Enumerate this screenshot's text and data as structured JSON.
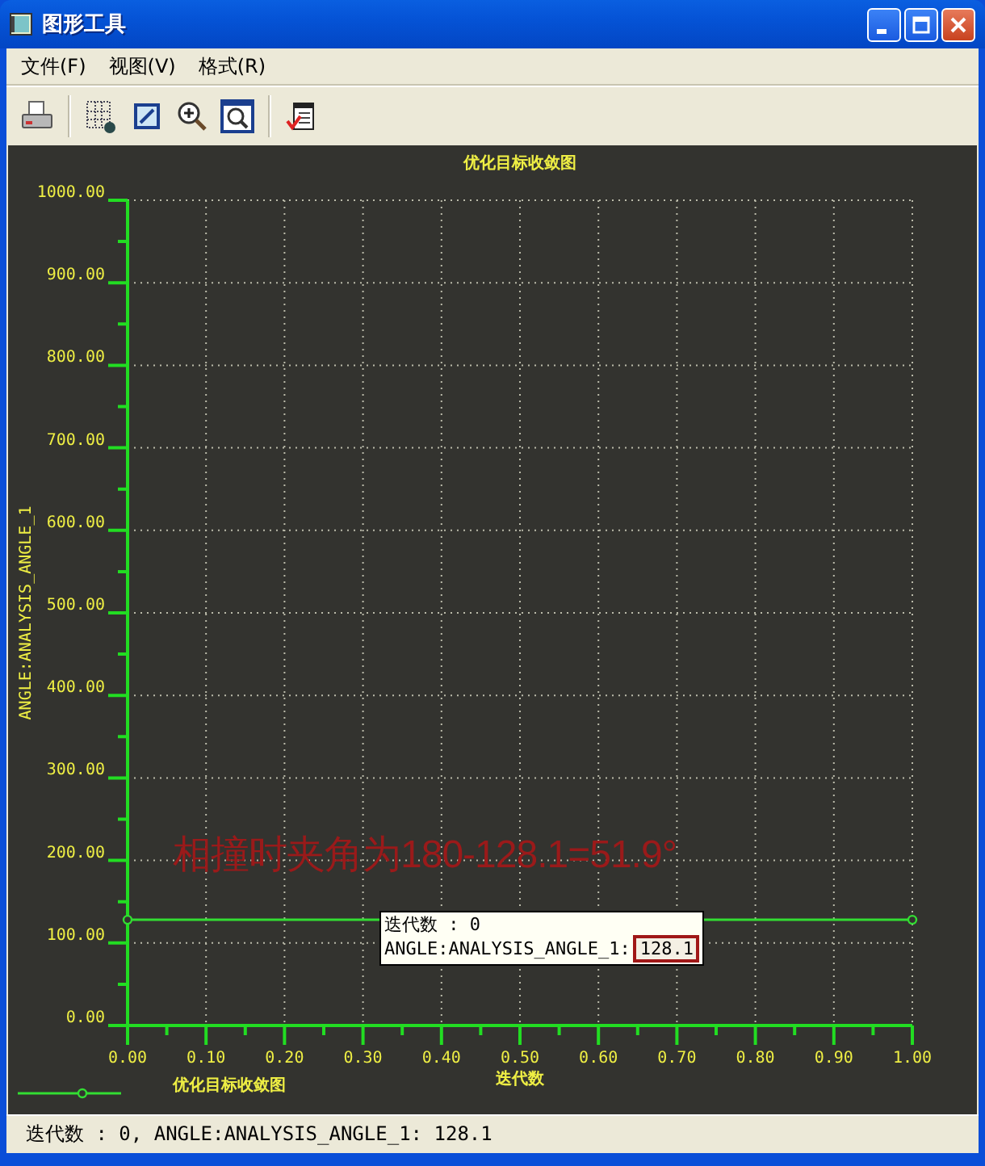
{
  "window": {
    "title": "图形工具"
  },
  "menu": [
    {
      "label": "文件(F)"
    },
    {
      "label": "视图(V)"
    },
    {
      "label": "格式(R)"
    }
  ],
  "chart": {
    "chart_data": {
      "type": "line",
      "title": "优化目标收敛图",
      "xlabel": "迭代数",
      "ylabel": "ANGLE:ANALYSIS_ANGLE_1",
      "x": [
        0,
        1
      ],
      "series": [
        {
          "name": "优化目标收敛图",
          "color": "#33dd33",
          "values": [
            128.1,
            128.1
          ]
        }
      ],
      "xlim": [
        0,
        1
      ],
      "ylim": [
        0,
        1000
      ],
      "grid": true,
      "marker": true,
      "xticks": [
        {
          "value": 0,
          "label": "0.00"
        },
        {
          "value": 0.1,
          "label": "0.10"
        },
        {
          "value": 0.2,
          "label": "0.20"
        },
        {
          "value": 0.3,
          "label": "0.30"
        },
        {
          "value": 0.4,
          "label": "0.40"
        },
        {
          "value": 0.5,
          "label": "0.50"
        },
        {
          "value": 0.6,
          "label": "0.60"
        },
        {
          "value": 0.7,
          "label": "0.70"
        },
        {
          "value": 0.8,
          "label": "0.80"
        },
        {
          "value": 0.9,
          "label": "0.90"
        },
        {
          "value": 1,
          "label": "1.00"
        }
      ],
      "yticks": [
        {
          "value": 0,
          "label": "0.00"
        },
        {
          "value": 100,
          "label": "100.00"
        },
        {
          "value": 200,
          "label": "200.00"
        },
        {
          "value": 300,
          "label": "300.00"
        },
        {
          "value": 400,
          "label": "400.00"
        },
        {
          "value": 500,
          "label": "500.00"
        },
        {
          "value": 600,
          "label": "600.00"
        },
        {
          "value": 700,
          "label": "700.00"
        },
        {
          "value": 800,
          "label": "800.00"
        },
        {
          "value": 900,
          "label": "900.00"
        },
        {
          "value": 1000,
          "label": "1000.00"
        }
      ]
    },
    "annotation": "相撞时夹角为180-128.1=51.9°",
    "tooltip": {
      "x_text": "迭代数 : 0",
      "y_label": "ANGLE:ANALYSIS_ANGLE_1:",
      "y_value": "128.1"
    }
  },
  "status_bar": {
    "text": "迭代数 : 0, ANGLE:ANALYSIS_ANGLE_1: 128.1"
  }
}
